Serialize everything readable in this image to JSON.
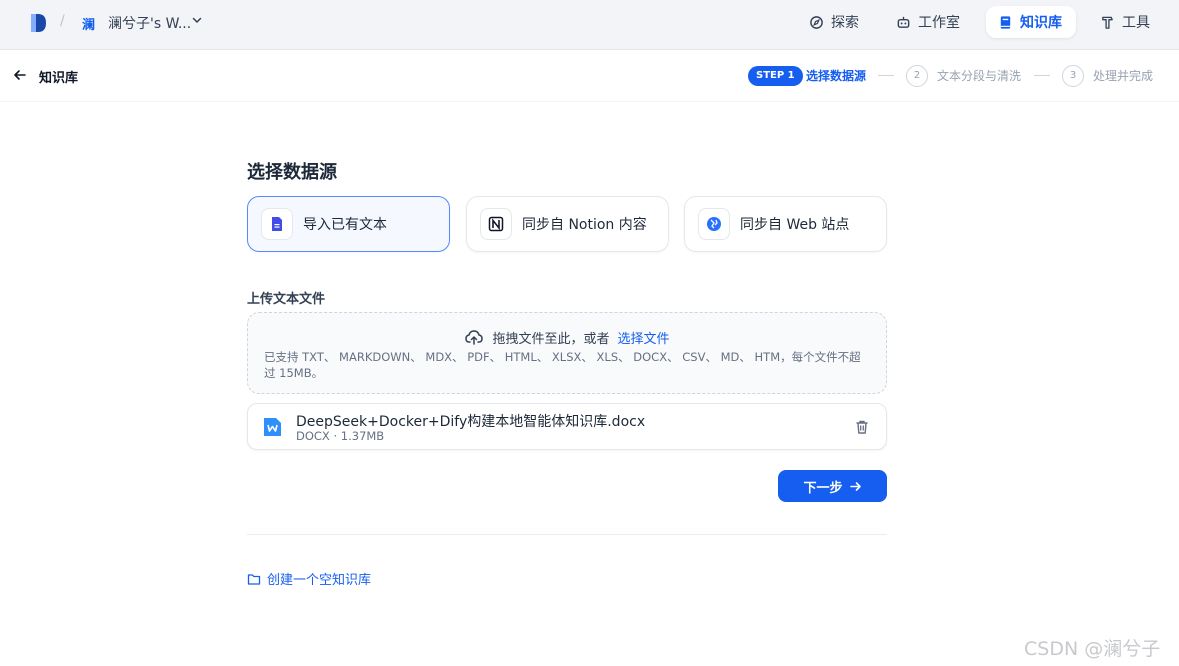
{
  "topbar": {
    "workspace_badge": "澜",
    "workspace_name": "澜兮子's W...",
    "nav": [
      {
        "label": "探索",
        "icon": "explore-icon",
        "active": false
      },
      {
        "label": "工作室",
        "icon": "robot-icon",
        "active": false
      },
      {
        "label": "知识库",
        "icon": "book-icon",
        "active": true
      },
      {
        "label": "工具",
        "icon": "hammer-icon",
        "active": false
      }
    ]
  },
  "subheader": {
    "title": "知识库",
    "steps": [
      {
        "badge": "STEP 1",
        "label": "选择数据源",
        "active": true
      },
      {
        "badge": "2",
        "label": "文本分段与清洗",
        "active": false
      },
      {
        "badge": "3",
        "label": "处理并完成",
        "active": false
      }
    ]
  },
  "main": {
    "title": "选择数据源",
    "sources": [
      {
        "label": "导入已有文本",
        "icon": "document-icon",
        "selected": true
      },
      {
        "label": "同步自 Notion 内容",
        "icon": "notion-icon",
        "selected": false
      },
      {
        "label": "同步自 Web 站点",
        "icon": "web-icon",
        "selected": false
      }
    ],
    "upload": {
      "title": "上传文本文件",
      "drop_text": "拖拽文件至此，或者",
      "drop_link": "选择文件",
      "support_text": "已支持 TXT、 MARKDOWN、 MDX、 PDF、 HTML、 XLSX、 XLS、 DOCX、 CSV、 MD、 HTM，每个文件不超过 15MB。"
    },
    "file": {
      "name": "DeepSeek+Docker+Dify构建本地智能体知识库.docx",
      "meta": "DOCX · 1.37MB"
    },
    "next_button": "下一步",
    "create_empty": "创建一个空知识库"
  },
  "watermark": "CSDN @澜兮子",
  "colors": {
    "accent": "#155eef",
    "topbar_bg": "#f2f4f7",
    "selected_card_bg": "#f5f8ff"
  }
}
